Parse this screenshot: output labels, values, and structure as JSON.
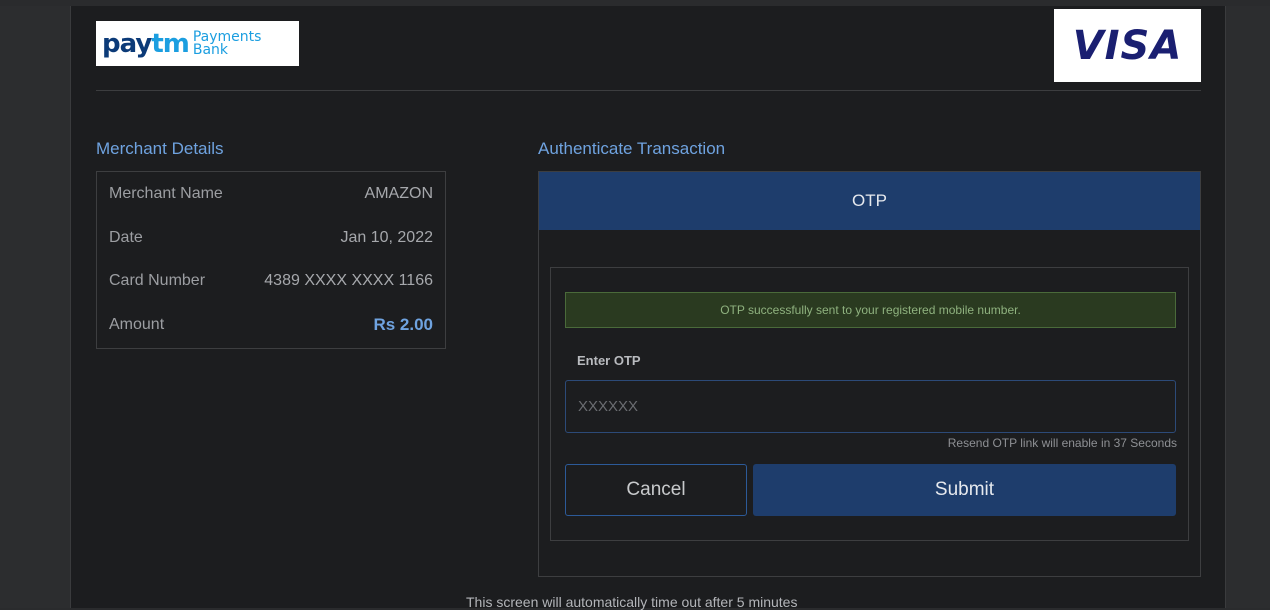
{
  "logos": {
    "paytm": {
      "brand": "paytm",
      "pay": "pay",
      "tm": "tm",
      "sub_line1": "Payments",
      "sub_line2": "Bank"
    },
    "visa": {
      "text": "VISA"
    }
  },
  "merchant": {
    "title": "Merchant Details",
    "rows": [
      {
        "label": "Merchant Name",
        "value": "AMAZON"
      },
      {
        "label": "Date",
        "value": "Jan 10, 2022"
      },
      {
        "label": "Card Number",
        "value": "4389 XXXX XXXX 1166"
      },
      {
        "label": "Amount",
        "value": "Rs 2.00"
      }
    ]
  },
  "auth": {
    "title": "Authenticate Transaction",
    "tab_label": "OTP",
    "alert": "OTP successfully sent to your registered mobile number.",
    "enter_label": "Enter OTP",
    "otp_placeholder": "XXXXXX",
    "otp_value": "",
    "resend_text": "Resend OTP link will enable in 37 Seconds",
    "cancel_label": "Cancel",
    "submit_label": "Submit"
  },
  "footer": {
    "timeout_text": "This screen will automatically time out after 5 minutes"
  },
  "colors": {
    "accent": "#6fa3e0",
    "primary_button": "#1e3d6c",
    "success_bg": "#2a3a20"
  }
}
